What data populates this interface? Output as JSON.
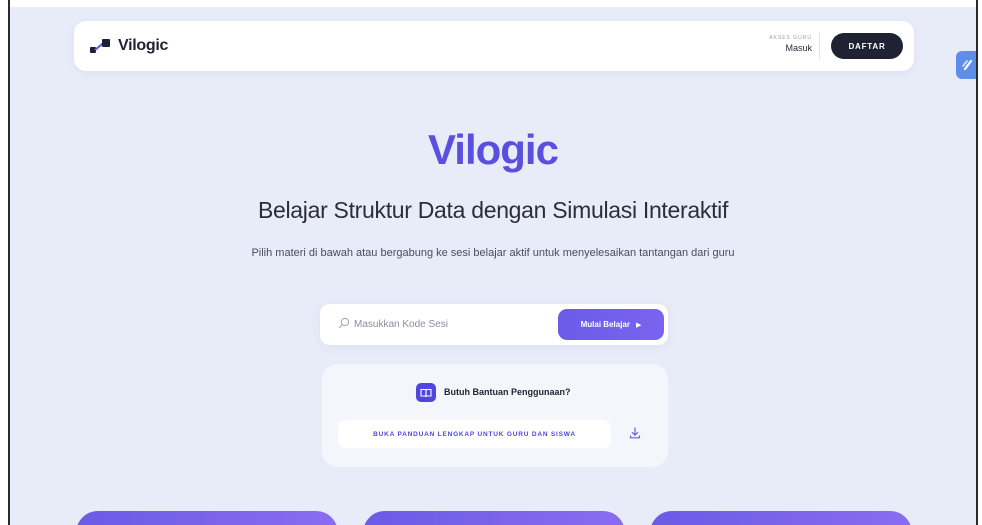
{
  "navbar": {
    "brand_name": "Vilogic",
    "login_caption": "AKSES GURU",
    "login_label": "Masuk",
    "signup_label": "DAFTAR"
  },
  "hero": {
    "title": "Vilogic",
    "subtitle": "Belajar Struktur Data dengan Simulasi Interaktif",
    "description": "Pilih materi di bawah atau bergabung ke sesi belajar aktif untuk menyelesaikan tantangan dari guru"
  },
  "session": {
    "placeholder": "Masukkan Kode Sesi",
    "value": "",
    "button_label": "Mulai Belajar",
    "button_icon": "play-icon"
  },
  "help": {
    "icon": "book-icon",
    "title": "Butuh Bantuan Penggunaan?",
    "guide_button_label": "BUKA PANDUAN LENGKAP UNTUK GURU DAN SISWA",
    "download_icon": "download-icon"
  },
  "colors": {
    "accent": "#5b4fe0",
    "background": "#e8ebf8",
    "dark_button": "#1e2233",
    "widget": "#5d8fe8"
  }
}
